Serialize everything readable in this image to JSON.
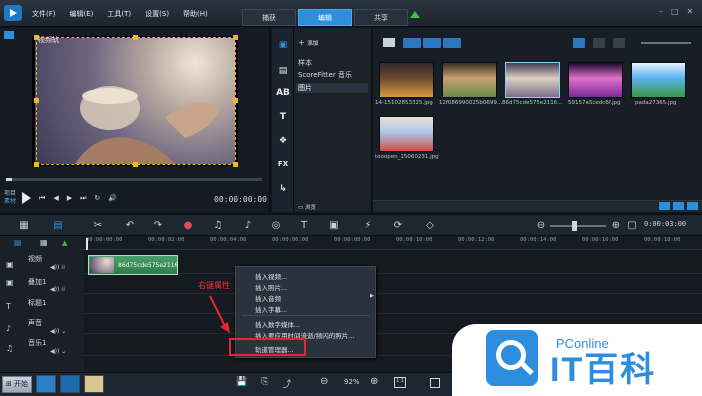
{
  "menu": [
    "文件(F)",
    "编辑(E)",
    "工具(T)",
    "设置(S)",
    "帮助(H)"
  ],
  "tabs": [
    "捕获",
    "编辑",
    "共享"
  ],
  "active_tab_index": 1,
  "window_controls": [
    "–",
    "□",
    "✕"
  ],
  "preview": {
    "overlay_label": "视频轨",
    "modes": [
      "项目",
      "素材"
    ],
    "timecode": "00:00:00:00"
  },
  "library": {
    "add_label": "添加",
    "items": [
      "样本",
      "ScoreFitter 音乐",
      "图片"
    ],
    "selected_index": 2,
    "browse_label": "浏览"
  },
  "media": [
    {
      "caption": "14-15102853325.jpg",
      "palette": [
        "#6b4a2a",
        "#d89a48",
        "#2f2a30"
      ]
    },
    {
      "caption": "12f086990025b0699...",
      "palette": [
        "#c8a070",
        "#6a8a4a",
        "#3a3020"
      ]
    },
    {
      "caption": "86d75cde575e2116...",
      "palette": [
        "#ddd0c4",
        "#7a7088",
        "#403c55"
      ]
    },
    {
      "caption": "59157a5cedc6f.jpg",
      "palette": [
        "#e070c8",
        "#7a2a9a",
        "#1a0a30"
      ]
    },
    {
      "caption": "pada27365.jpg",
      "palette": [
        "#58b0f0",
        "#3a9a40",
        "#e8f4ff"
      ]
    },
    {
      "caption": "tooopen_15060231.jpg",
      "palette": [
        "#a8c8e8",
        "#d84a4a",
        "#f0e0d0"
      ]
    }
  ],
  "timeline": {
    "zoom_timecode": "0:00:03:00",
    "ruler": [
      "00:00:00:00",
      "00:00:02:00",
      "00:00:04:00",
      "00:00:06:00",
      "00:00:08:00",
      "00:00:10:00",
      "00:00:12:00",
      "00:00:14:00",
      "00:00:16:00",
      "00:00:18:00"
    ],
    "tracks": [
      "视频",
      "叠加1",
      "标题1",
      "声音",
      "音乐1"
    ],
    "clip_label": "86d75cde575e2116"
  },
  "context_menu": [
    "插入视频...",
    "插入照片...",
    "插入音频",
    "插入字幕...",
    "插入数字媒体...",
    "插入要应用时间流逝/频闪的照片...",
    "轨道管理器..."
  ],
  "annotation_label": "右键属性",
  "taskbar": {
    "start_label": "开始"
  },
  "zoom_percent": "92%",
  "brand": {
    "top": "PConline",
    "big": "IT百科"
  },
  "colors": {
    "accent": "#2e8fd8",
    "highlight": "#e0282a",
    "clip": "#3a8a58"
  }
}
